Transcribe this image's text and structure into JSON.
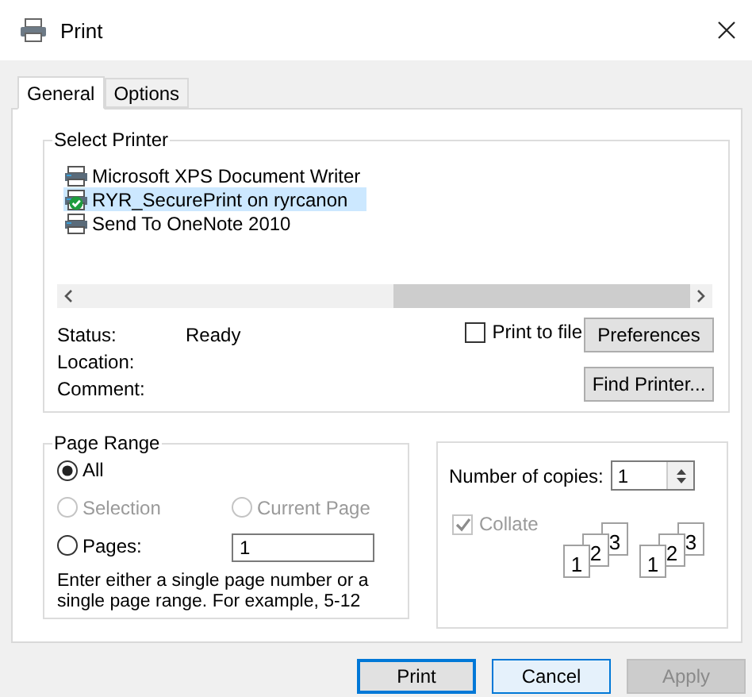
{
  "window": {
    "title": "Print"
  },
  "tabs": [
    {
      "label": "General",
      "selected": true
    },
    {
      "label": "Options",
      "selected": false
    }
  ],
  "select_printer": {
    "title": "Select Printer",
    "printers": [
      {
        "name": "Microsoft XPS Document Writer",
        "selected": false,
        "default": false
      },
      {
        "name": "RYR_SecurePrint on ryrcanon",
        "selected": true,
        "default": true
      },
      {
        "name": "Send To OneNote 2010",
        "selected": false,
        "default": false
      }
    ],
    "info": [
      {
        "label": "Status:",
        "value": "Ready"
      },
      {
        "label": "Location:"
      },
      {
        "label": "Comment:"
      }
    ],
    "print_to_file": {
      "label": "Print to file",
      "checked": false
    },
    "buttons": [
      "Preferences",
      "Find Printer..."
    ]
  },
  "page_range": {
    "title": "Page Range",
    "options": [
      {
        "label": "All",
        "selected": true,
        "disabled": false
      },
      {
        "label": "Selection",
        "selected": false,
        "disabled": true
      },
      {
        "label": "Current Page",
        "selected": false,
        "disabled": true
      },
      {
        "label": "Pages:",
        "selected": false,
        "disabled": false
      }
    ],
    "pages_value": "1",
    "hint": "Enter either a single page number or a single page range.  For example, 5-12"
  },
  "copies": {
    "label": "Number of copies:",
    "value": "1",
    "collate": {
      "label": "Collate",
      "checked": true,
      "disabled": true
    },
    "stacks": [
      [
        "1",
        "2",
        "3"
      ],
      [
        "1",
        "2",
        "3"
      ]
    ]
  },
  "buttons": [
    {
      "label": "Print",
      "default": true,
      "hovered": false,
      "disabled": false
    },
    {
      "label": "Cancel",
      "default": false,
      "hovered": true,
      "disabled": false
    },
    {
      "label": "Apply",
      "default": false,
      "hovered": false,
      "disabled": true
    }
  ]
}
